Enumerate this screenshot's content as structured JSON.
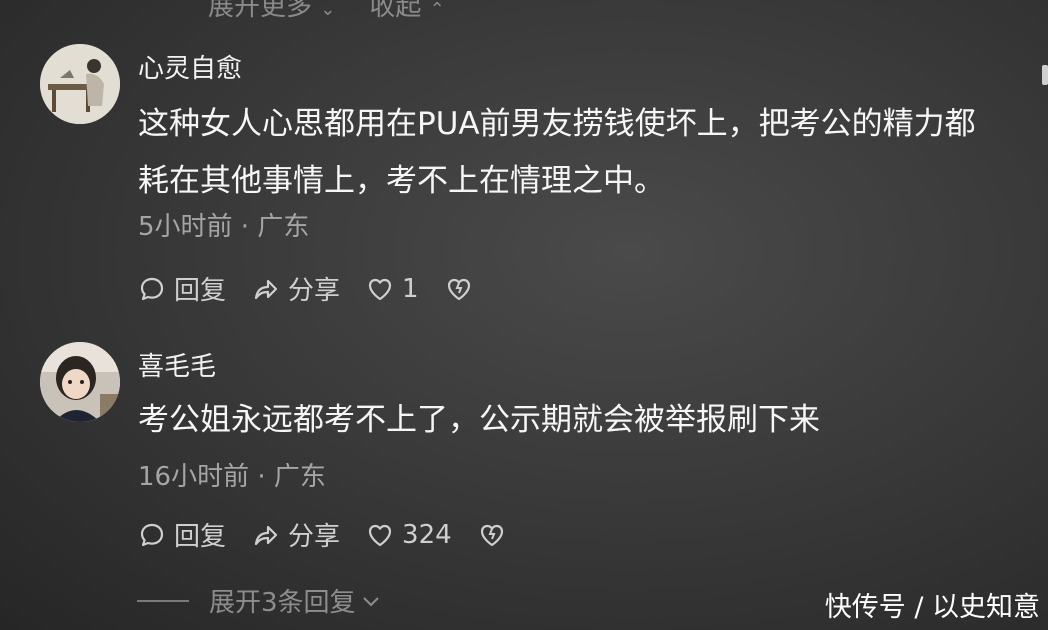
{
  "top_partial": {
    "left": "展开更多",
    "right": "收起"
  },
  "comments": [
    {
      "username": "心灵自愈",
      "lines": [
        "这种女人心思都用在PUA前男友捞钱使坏上，把考公的精力都",
        "耗在其他事情上，考不上在情理之中。"
      ],
      "meta": "5小时前 · 广东",
      "reply_label": "回复",
      "share_label": "分享",
      "like_count": "1"
    },
    {
      "username": "喜毛毛",
      "lines": [
        "考公姐永远都考不上了，公示期就会被举报刷下来"
      ],
      "meta": "16小时前 · 广东",
      "reply_label": "回复",
      "share_label": "分享",
      "like_count": "324"
    }
  ],
  "expand_replies": "展开3条回复",
  "watermark": "快传号 / 以史知意",
  "icons": [
    "chat-bubble-icon",
    "share-arrow-icon",
    "heart-icon",
    "broken-heart-icon",
    "chevron-down-icon"
  ]
}
